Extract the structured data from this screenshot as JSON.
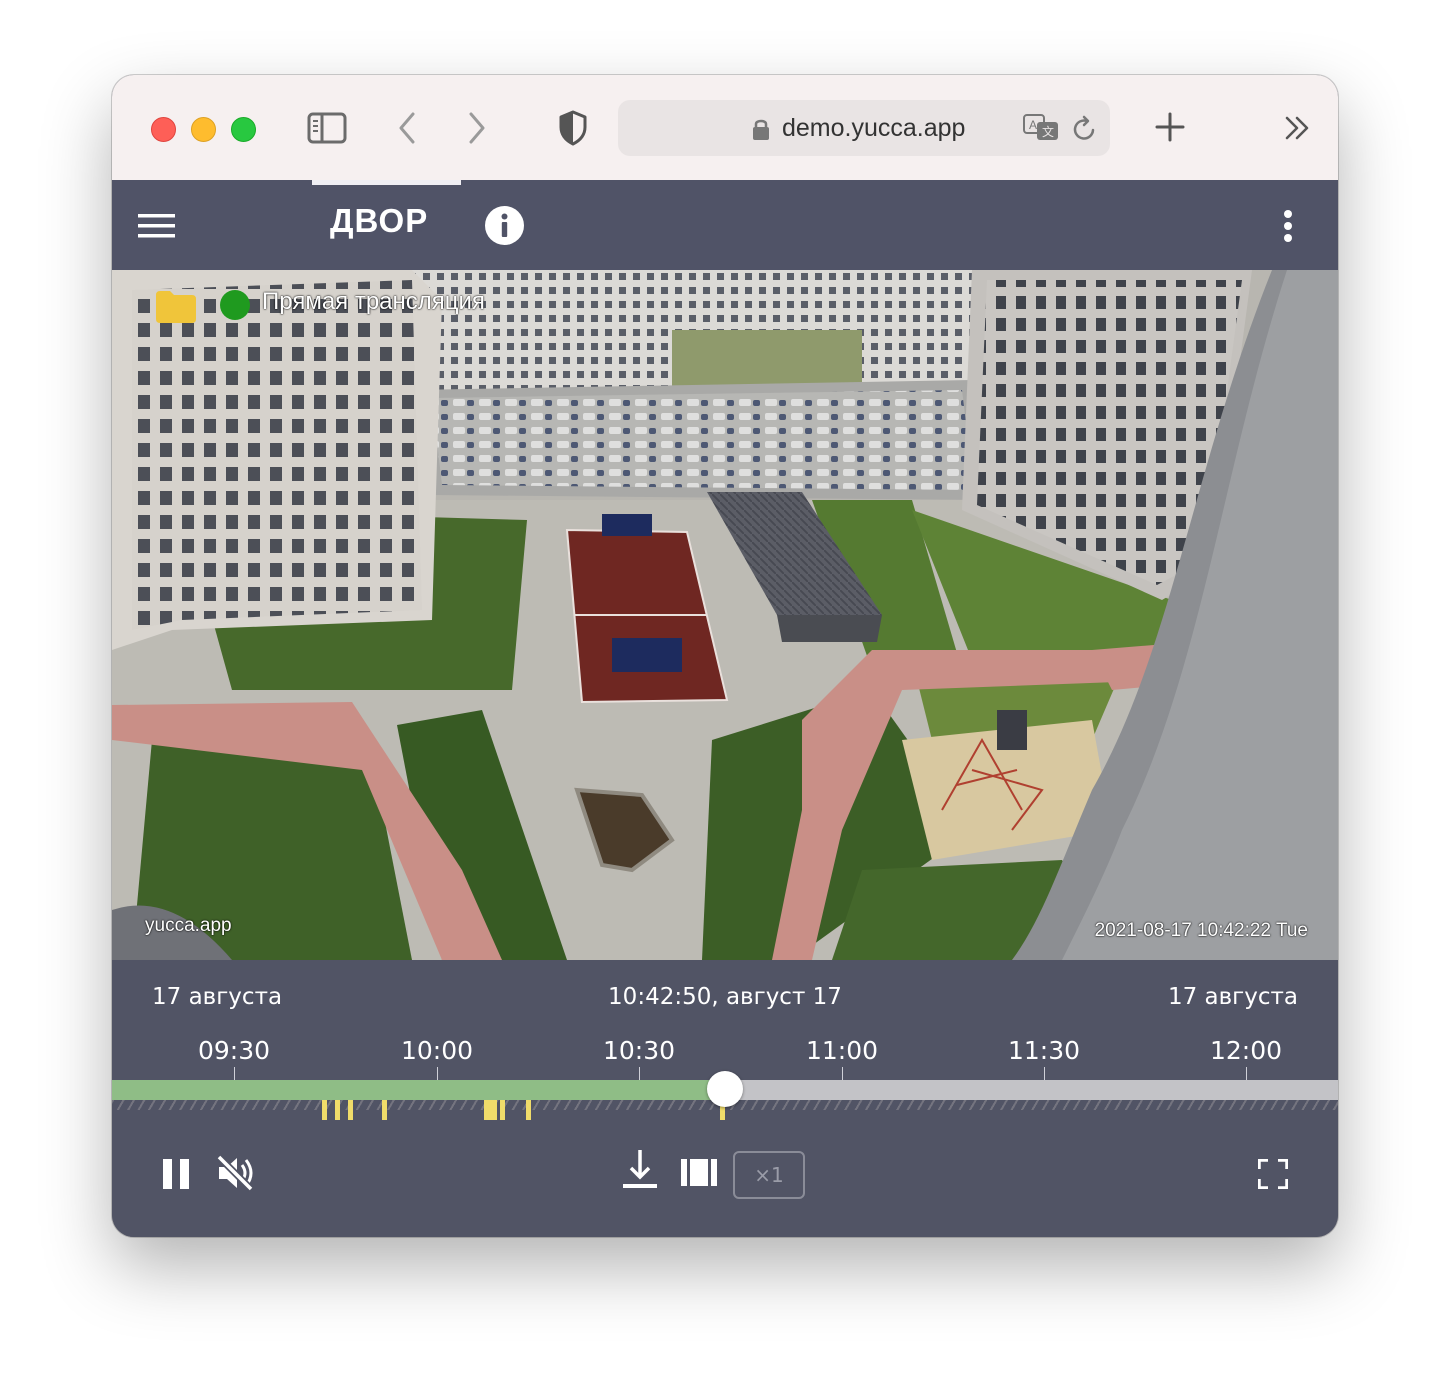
{
  "browser": {
    "url": "demo.yucca.app"
  },
  "app": {
    "camera_title": "ДВОР"
  },
  "video": {
    "status_label": "Прямая трансляция",
    "watermark": "yucca.app",
    "timestamp": "2021-08-17 10:42:22 Tue"
  },
  "timeline": {
    "date_left": "17 августа",
    "current_time": "10:42:50, август 17",
    "date_right": "17 августа",
    "ticks": [
      "09:30",
      "10:00",
      "10:30",
      "11:00",
      "11:30",
      "12:00"
    ],
    "played_fraction": 0.5
  },
  "controls": {
    "speed": "×1"
  },
  "colors": {
    "toolbar_bg": "#f6f0f0",
    "appbar_bg": "#505367",
    "timeline_bg": "#515465",
    "played": "#8fbd86",
    "event": "#f0dc6a",
    "live_dot": "#1f9a1f",
    "folder": "#f0c53a"
  },
  "icons": [
    "sidebar-icon",
    "back-icon",
    "forward-icon",
    "shield-icon",
    "lock-icon",
    "translate-icon",
    "reload-icon",
    "new-tab-icon",
    "more-tabs-icon",
    "menu-icon",
    "info-icon",
    "kebab-icon",
    "folder-icon",
    "pause-icon",
    "mute-icon",
    "download-icon",
    "film-icon",
    "fullscreen-icon"
  ]
}
